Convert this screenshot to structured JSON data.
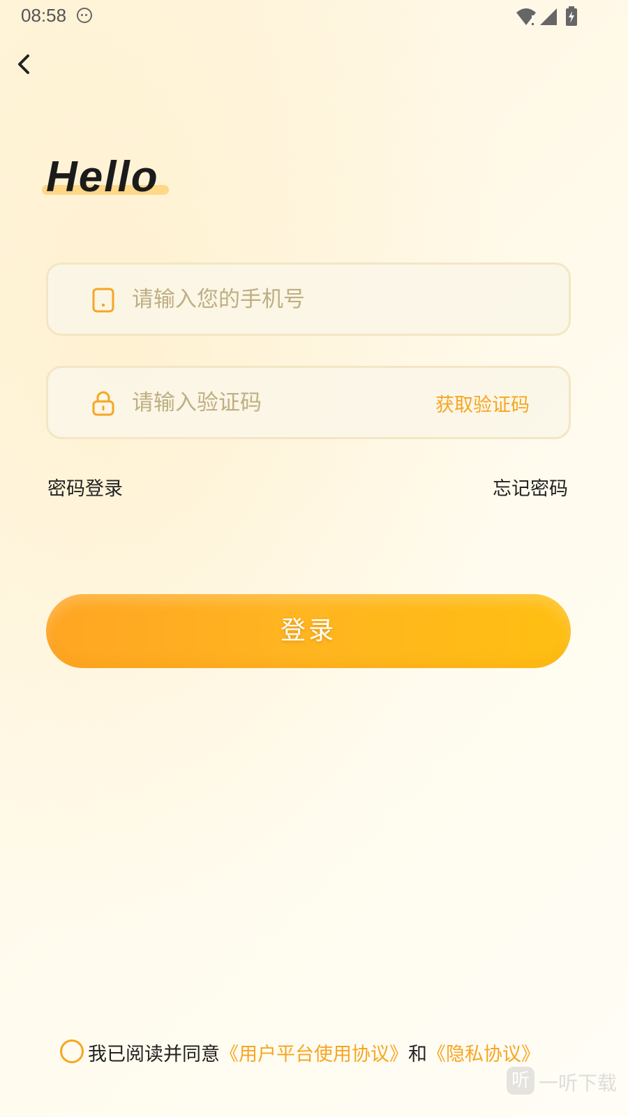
{
  "status_bar": {
    "time": "08:58"
  },
  "hello": "Hello",
  "phone_field": {
    "placeholder": "请输入您的手机号",
    "icon": "phone-icon"
  },
  "code_field": {
    "placeholder": "请输入验证码",
    "icon": "lock-icon",
    "get_code": "获取验证码"
  },
  "links": {
    "password_login": "密码登录",
    "forgot_password": "忘记密码"
  },
  "login_button": "登录",
  "agreement": {
    "prefix": "我已阅读并同意",
    "user_agreement": "《用户平台使用协议》",
    "and": "和",
    "privacy": "《隐私协议》",
    "checked": false
  },
  "watermark": {
    "badge": "听",
    "text": "一听下载"
  },
  "colors": {
    "accent": "#f6a623",
    "button_start": "#ffa522",
    "button_end": "#ffbf12",
    "placeholder": "#bfae84"
  }
}
